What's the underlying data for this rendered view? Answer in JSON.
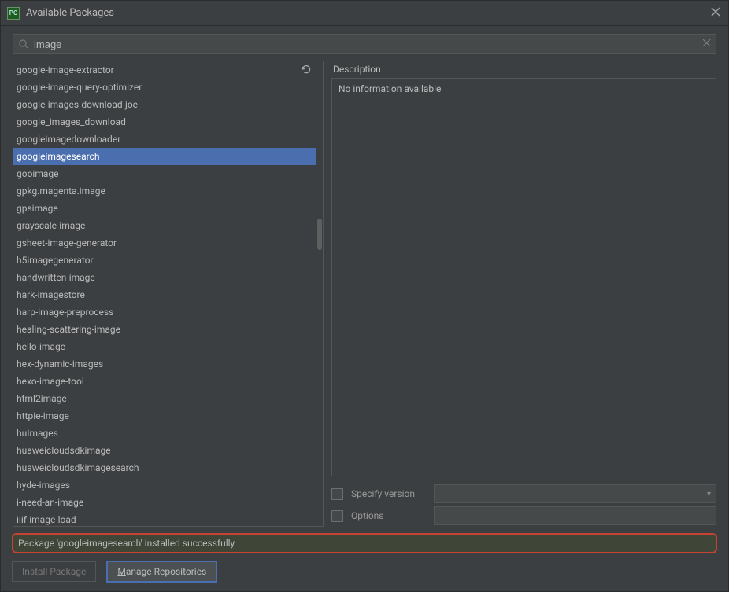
{
  "window": {
    "app_short": "PC",
    "title": "Available Packages"
  },
  "search": {
    "value": "image",
    "placeholder": ""
  },
  "packages": [
    "google-image-extractor",
    "google-image-query-optimizer",
    "google-images-download-joe",
    "google_images_download",
    "googleimagedownloader",
    "googleimagesearch",
    "gooimage",
    "gpkg.magenta.image",
    "gpsimage",
    "grayscale-image",
    "gsheet-image-generator",
    "h5imagegenerator",
    "handwritten-image",
    "hark-imagestore",
    "harp-image-preprocess",
    "healing-scattering-image",
    "hello-image",
    "hex-dynamic-images",
    "hexo-image-tool",
    "html2image",
    "httpie-image",
    "huImages",
    "huaweicloudsdkimage",
    "huaweicloudsdkimagesearch",
    "hyde-images",
    "i-need-an-image",
    "iiif-image-load"
  ],
  "selected_index": 5,
  "description": {
    "header": "Description",
    "body": "No information available"
  },
  "options": {
    "specify_version_label": "Specify version",
    "specify_version_value": "",
    "options_label": "Options",
    "options_value": ""
  },
  "status": {
    "message": "Package 'googleimagesearch' installed successfully"
  },
  "buttons": {
    "install": "Install Package",
    "manage_pre": "M",
    "manage_rest": "anage Repositories"
  }
}
